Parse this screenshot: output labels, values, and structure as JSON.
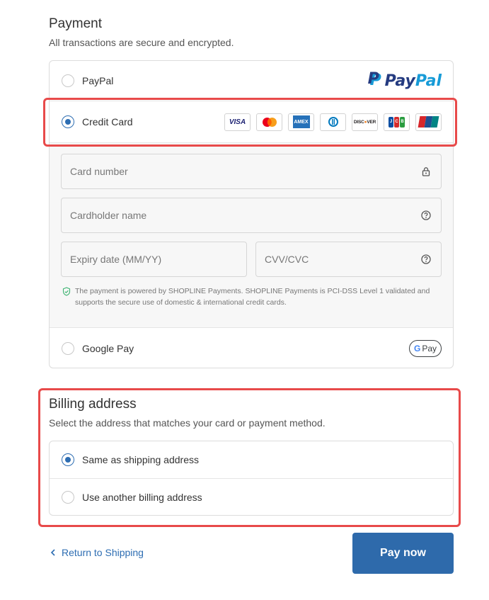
{
  "payment": {
    "title": "Payment",
    "subtitle": "All transactions are secure and encrypted.",
    "methods": [
      {
        "label": "PayPal",
        "selected": false,
        "logo_text": {
          "pay": "Pay",
          "pal": "Pal"
        }
      },
      {
        "label": "Credit Card",
        "selected": true,
        "card_brands": [
          "VISA",
          "Mastercard",
          "AMEX",
          "Diners Club",
          "DISCOVER",
          "JCB",
          "UnionPay"
        ]
      },
      {
        "label": "Google Pay",
        "selected": false,
        "badge_text": "Pay"
      }
    ],
    "card_form": {
      "card_number_placeholder": "Card number",
      "cardholder_placeholder": "Cardholder name",
      "expiry_placeholder": "Expiry date (MM/YY)",
      "cvv_placeholder": "CVV/CVC",
      "security_note": "The payment is powered by SHOPLINE Payments. SHOPLINE Payments is PCI-DSS Level 1 validated and supports the secure use of domestic & international credit cards."
    }
  },
  "billing": {
    "title": "Billing address",
    "subtitle": "Select the address that matches your card or payment method.",
    "options": [
      {
        "label": "Same as shipping address",
        "selected": true
      },
      {
        "label": "Use another billing address",
        "selected": false
      }
    ]
  },
  "footer": {
    "return_label": "Return to Shipping",
    "pay_label": "Pay now"
  },
  "colors": {
    "accent": "#2d6db2",
    "pay_button": "#2e6aab",
    "highlight": "#e84a4a",
    "paypal_dark": "#253b80",
    "paypal_light": "#179bd7"
  }
}
